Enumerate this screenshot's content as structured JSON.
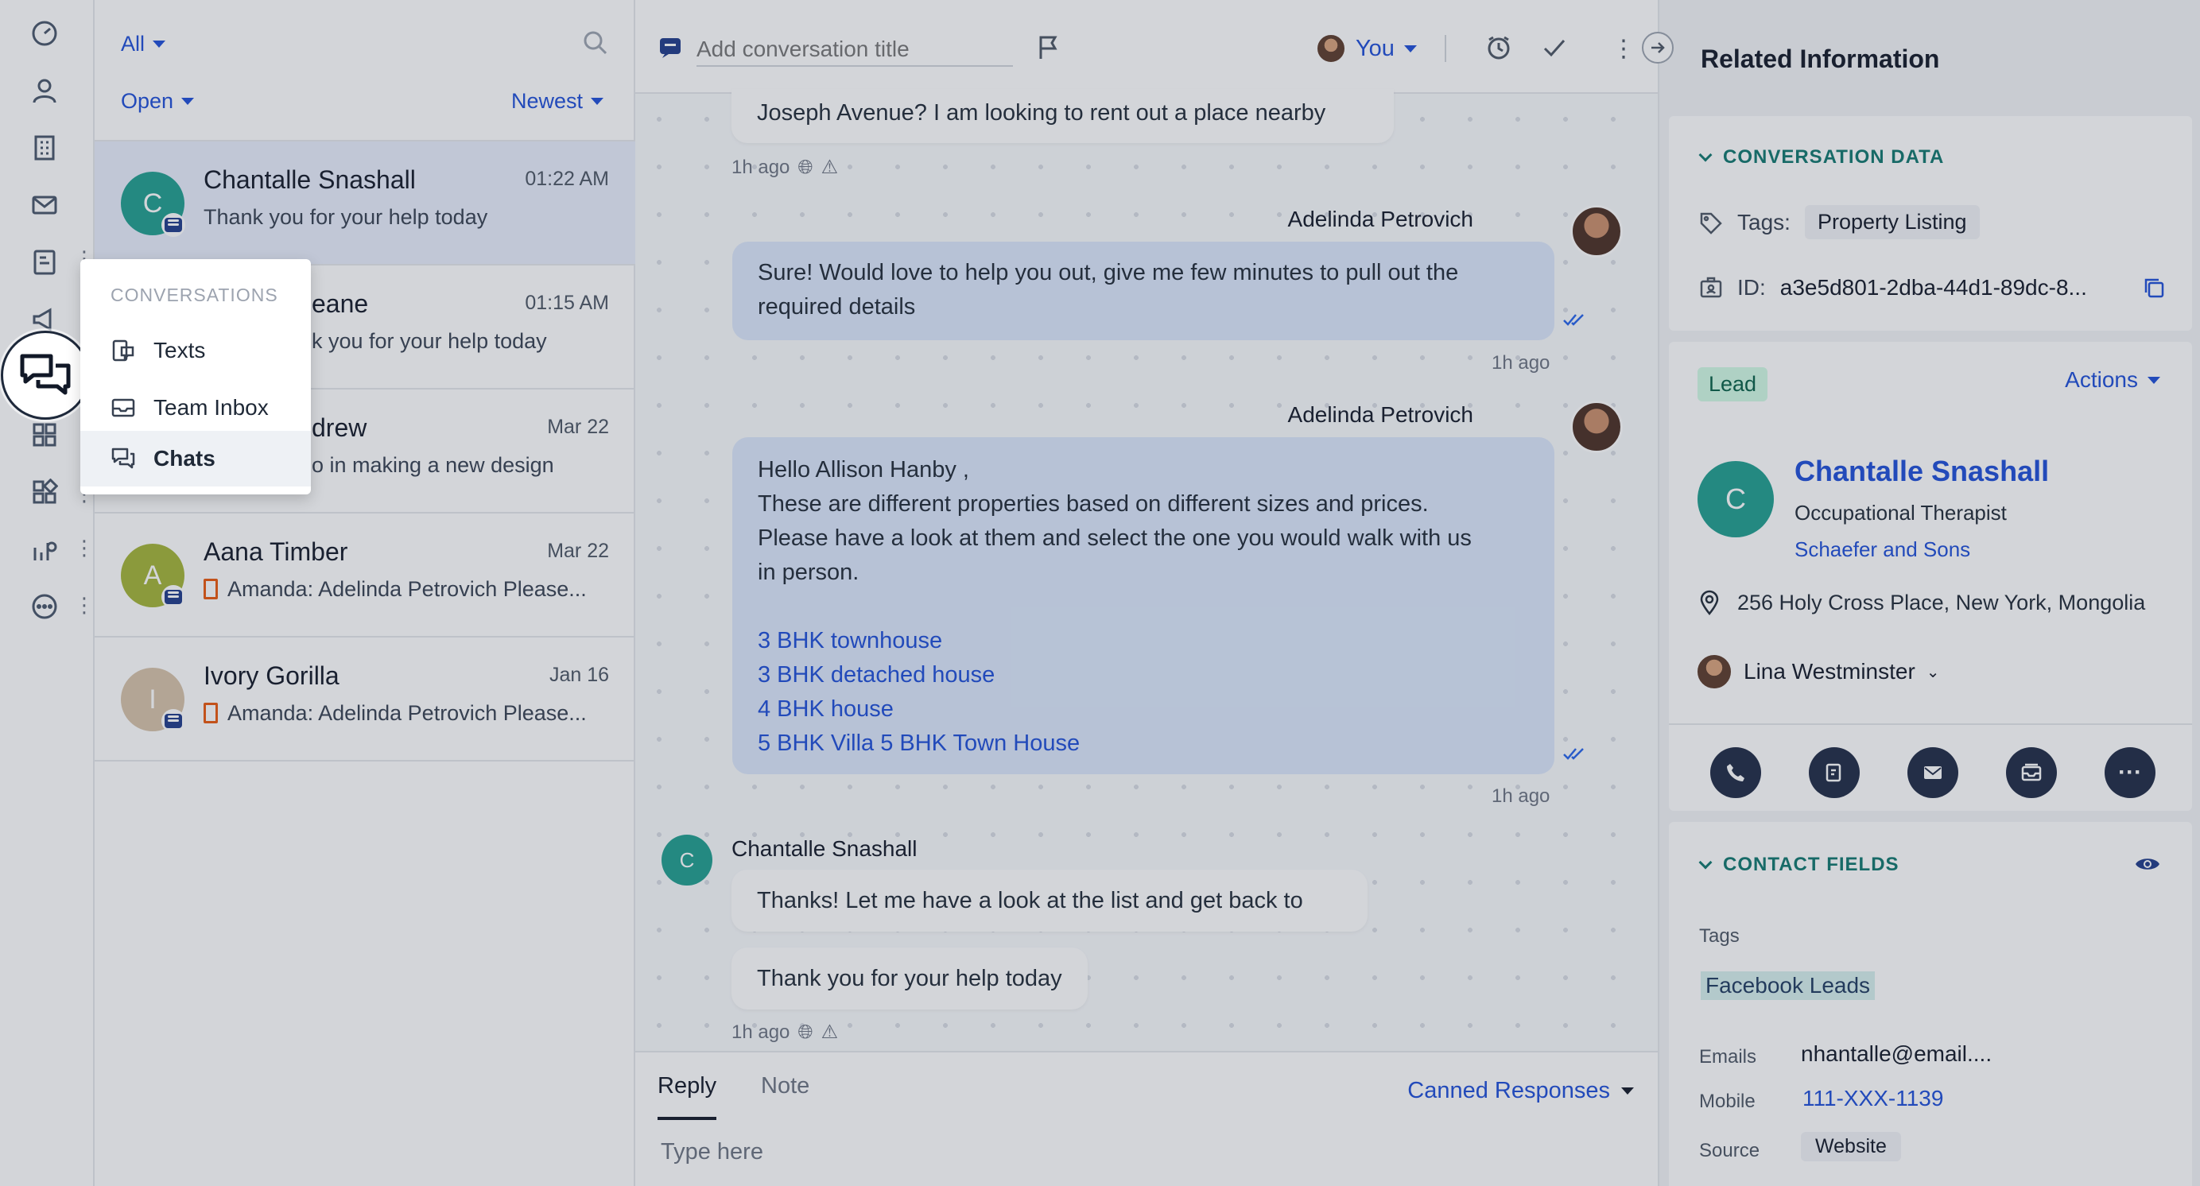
{
  "rail": {
    "icons": [
      "dashboard-icon",
      "contacts-icon",
      "building-icon",
      "mail-icon",
      "notes-icon",
      "megaphone-icon",
      "conversations-icon",
      "apps-icon",
      "apps-alt-icon",
      "reports-icon",
      "more-icon"
    ]
  },
  "list": {
    "filter_all": "All",
    "filter_status": "Open",
    "filter_sort": "Newest",
    "conversations": [
      {
        "initial": "C",
        "name": "Chantalle Snashall",
        "time": "01:22 AM",
        "preview": "Thank you for your help today",
        "color": "#1f9e8f"
      },
      {
        "initial": "",
        "name": "eane",
        "time": "01:15 AM",
        "preview": "k you for your help today",
        "color": "#6366f1"
      },
      {
        "initial": "",
        "name": "drew",
        "time": "Mar 22",
        "preview": "o in making a new design",
        "color": "#9ca3af"
      },
      {
        "initial": "A",
        "name": "Aana Timber",
        "time": "Mar 22",
        "preview": "Amanda: Adelinda Petrovich Please...",
        "color": "#a3b437"
      },
      {
        "initial": "I",
        "name": "Ivory Gorilla",
        "time": "Jan 16",
        "preview": "Amanda: Adelinda Petrovich Please...",
        "color": "#d6c2a8"
      }
    ]
  },
  "popover": {
    "heading": "CONVERSATIONS",
    "items": [
      {
        "label": "Texts",
        "icon": "texts-icon"
      },
      {
        "label": "Team Inbox",
        "icon": "inbox-icon"
      },
      {
        "label": "Chats",
        "icon": "chats-icon"
      }
    ]
  },
  "chat": {
    "title_placeholder": "Add conversation title",
    "assignee": "You",
    "messages": {
      "m1_text": "Joseph Avenue? I am looking to rent out a place nearby",
      "m1_meta": "1h ago",
      "m2_sender": "Adelinda Petrovich",
      "m2_line1": "Sure! Would love to help you out, give me few minutes to pull out the",
      "m2_line2": "required details",
      "m2_meta": "1h ago",
      "m3_sender": "Adelinda Petrovich",
      "m3_line1": "Hello Allison Hanby ,",
      "m3_line2": "These are different properties based on different sizes and prices.",
      "m3_line3": "Please have a look at them and select the one you would walk with us",
      "m3_line4": "in person.",
      "m3_links": [
        "3 BHK townhouse",
        "3 BHK detached house",
        "4 BHK house",
        "5 BHK Villa 5 BHK Town House"
      ],
      "m3_meta": "1h ago",
      "m4_sender": "Chantalle Snashall",
      "m4_initial": "C",
      "m4_text": "Thanks! Let me have a look at the list and get back to you",
      "m5_text": "Thank you for your help today",
      "m5_meta": "1h ago"
    },
    "reply": {
      "tab_reply": "Reply",
      "tab_note": "Note",
      "canned": "Canned Responses",
      "placeholder": "Type here"
    }
  },
  "right": {
    "title": "Related Information",
    "conv_data": {
      "heading": "CONVERSATION DATA",
      "tags_label": "Tags:",
      "tag": "Property Listing",
      "id_label": "ID:",
      "id_value": "a3e5d801-2dba-44d1-89dc-8..."
    },
    "contact": {
      "badge": "Lead",
      "actions": "Actions",
      "initial": "C",
      "name": "Chantalle Snashall",
      "occupation": "Occupational Therapist",
      "company": "Schaefer and Sons",
      "address": "256 Holy Cross Place, New York, Mongolia",
      "owner": "Lina Westminster"
    },
    "fields": {
      "heading": "CONTACT FIELDS",
      "tags_label": "Tags",
      "tag": "Facebook Leads",
      "emails_label": "Emails",
      "emails_value": "nhantalle@email....",
      "mobile_label": "Mobile",
      "mobile_value": "111-XXX-1139",
      "source_label": "Source",
      "source_value": "Website"
    }
  },
  "colors": {
    "accent": "#1d4ed8",
    "teal": "#0f766e",
    "outgoing_bubble": "#dbe7fb",
    "selected_row": "#e8eefb"
  }
}
